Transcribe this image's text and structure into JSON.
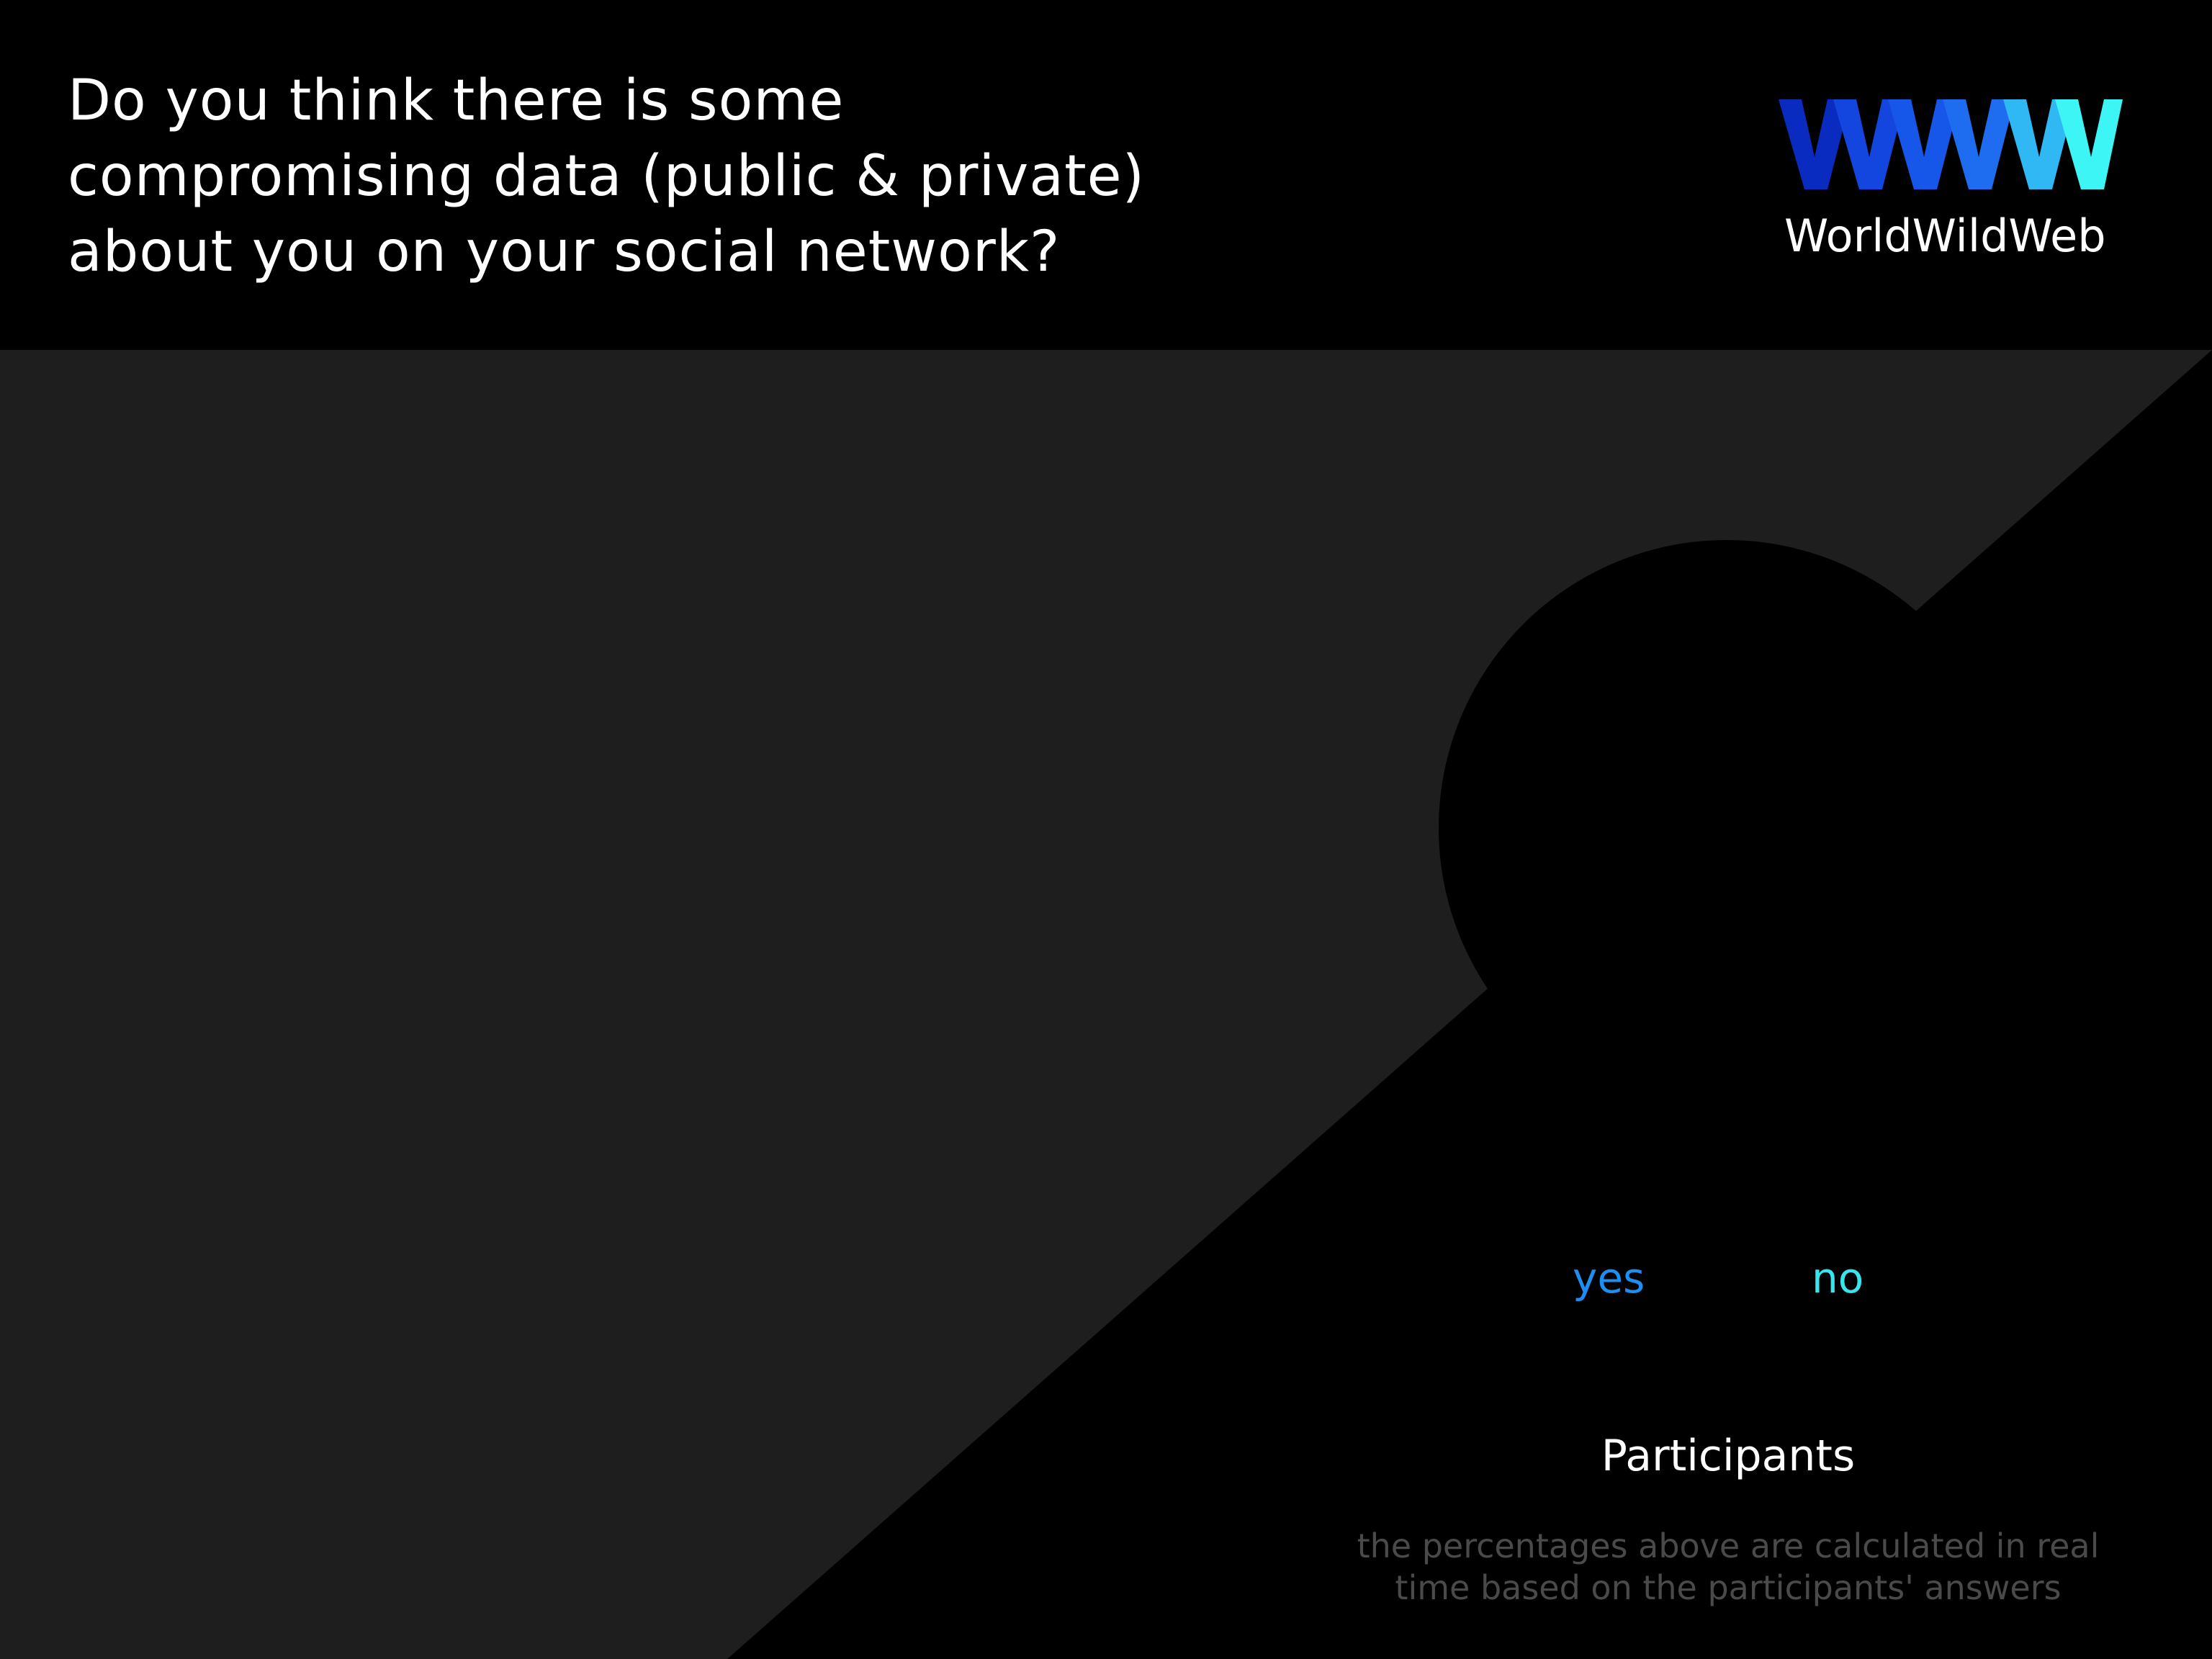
{
  "question": {
    "lines": [
      "Do you think there is some",
      "compromising data (public & private)",
      "about you on your social network?"
    ]
  },
  "logo": {
    "mark_icon": "www-logo-icon",
    "name": "WorldWildWeb",
    "colors": [
      "#0a2bbf",
      "#1246de",
      "#1e6df0",
      "#3df5f5"
    ]
  },
  "answers": {
    "yes": {
      "label": "yes",
      "color": "#1e8ff2"
    },
    "no": {
      "label": "no",
      "color": "#35e6ef"
    }
  },
  "participants": {
    "label": "Participants"
  },
  "footnote": {
    "lines": [
      "the percentages above are calculated in real",
      "time based on the participants' answers"
    ]
  },
  "colors": {
    "background": "#000000",
    "panel": "#1e1e1e"
  }
}
